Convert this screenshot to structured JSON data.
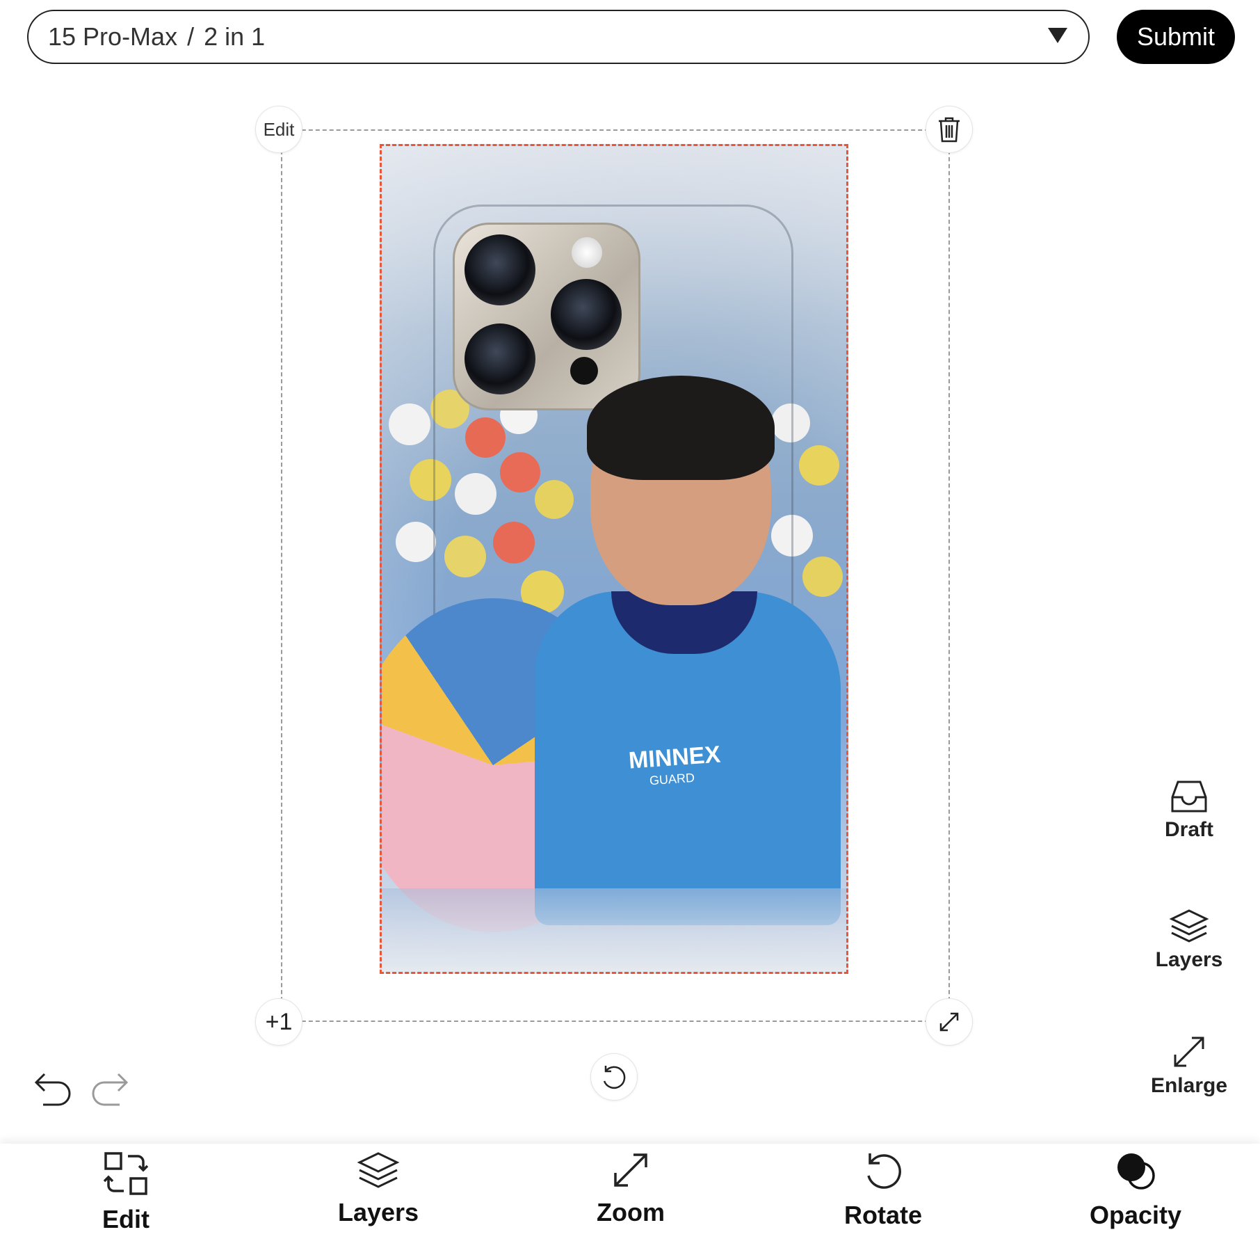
{
  "header": {
    "model": "15 Pro-Max",
    "separator": "/",
    "variant": "2 in 1",
    "submit_label": "Submit"
  },
  "canvas": {
    "edit_handle_label": "Edit",
    "add_handle_label": "+1",
    "shirt_text_main": "MINNEX",
    "shirt_text_sub": "GUARD"
  },
  "side_panel": {
    "draft_label": "Draft",
    "layers_label": "Layers",
    "enlarge_label": "Enlarge"
  },
  "toolbar": {
    "edit_label": "Edit",
    "layers_label": "Layers",
    "zoom_label": "Zoom",
    "rotate_label": "Rotate",
    "opacity_label": "Opacity"
  },
  "colors": {
    "accent": "#000000",
    "selection_border": "#e8573a",
    "frame_border": "#9a9a9a"
  },
  "icons": [
    "chevron-down-icon",
    "trash-icon",
    "resize-icon",
    "rotate-icon",
    "undo-icon",
    "redo-icon",
    "inbox-icon",
    "layers-icon",
    "enlarge-icon",
    "edit-swap-icon",
    "zoom-icon",
    "opacity-icon"
  ]
}
